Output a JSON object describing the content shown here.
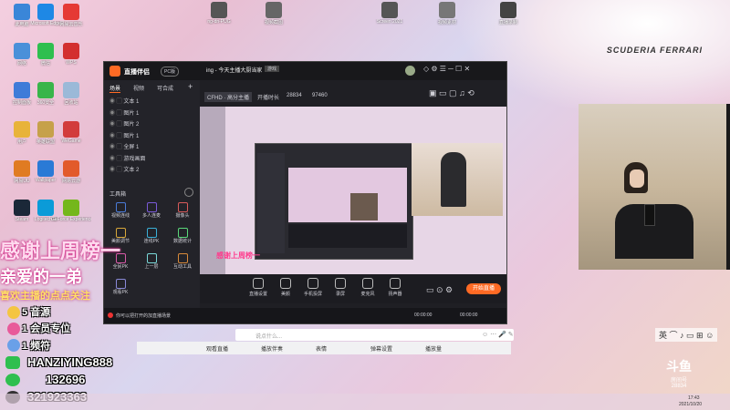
{
  "desktop": {
    "icons": [
      {
        "label": "此电脑",
        "color": "#3a86d8"
      },
      {
        "label": "Microsoft Edge",
        "color": "#1e88e5"
      },
      {
        "label": "网易云音乐",
        "color": "#e53935"
      },
      {
        "label": "网络",
        "color": "#4a90d9"
      },
      {
        "label": "微信",
        "color": "#2fbf4f"
      },
      {
        "label": "WPS",
        "color": "#d32f2f"
      },
      {
        "label": "控制面板",
        "color": "#3f7bd8"
      },
      {
        "label": "360安全",
        "color": "#39b54a"
      },
      {
        "label": "回收站",
        "color": "#9bb9d8"
      },
      {
        "label": "用户",
        "color": "#e8b33a"
      },
      {
        "label": "英雄联盟",
        "color": "#c6a14a"
      },
      {
        "label": "WeGame",
        "color": "#d23c3c"
      },
      {
        "label": "网易UU",
        "color": "#e07b22"
      },
      {
        "label": "Wallpaper",
        "color": "#2a7ad6"
      },
      {
        "label": "网易云游",
        "color": "#e25a2b"
      },
      {
        "label": "Steam",
        "color": "#1b2838"
      },
      {
        "label": "Logitech G",
        "color": "#0b9bd8"
      },
      {
        "label": "GeForce Experience",
        "color": "#74b71b"
      }
    ],
    "top_icons": [
      {
        "label": "ng-dn-PUG",
        "color": "#555"
      },
      {
        "label": "视频截图",
        "color": "#666"
      },
      {
        "label": "Screen 2021",
        "color": "#555"
      },
      {
        "label": "视频素材",
        "color": "#777"
      },
      {
        "label": "直播录制",
        "color": "#444"
      }
    ],
    "ferrari_text": "SCUDERIA FERRARI"
  },
  "obs": {
    "logo": "直播伴侣",
    "badge": "PC版",
    "tabs": [
      "场景",
      "视频",
      "可合成"
    ],
    "scenes": [
      "文本 1",
      "图片 1",
      "图片 2",
      "图片 1",
      "全屏 1",
      "游戏画面",
      "文本 2"
    ],
    "tool_title": "工具箱",
    "tools": [
      "视频连线",
      "多人连麦",
      "摄像头",
      "美颜调节",
      "连线PK",
      "数据统计",
      "全民PK",
      "上一层",
      "互动工具",
      "观看PK"
    ],
    "stream_title": "ing - 今天主播大厨当家",
    "stream_tag": "游戏",
    "sub_info": [
      "CFHD · 高分主播",
      "开播时长",
      "28834",
      "97460"
    ],
    "controls": [
      {
        "label": "直播设置",
        "icon": "monitor-icon"
      },
      {
        "label": "美颜",
        "icon": "face-icon"
      },
      {
        "label": "手机投屏",
        "icon": "phone-icon"
      },
      {
        "label": "录屏",
        "icon": "record-icon"
      },
      {
        "label": "麦克风",
        "icon": "mic-icon"
      },
      {
        "label": "扬声器",
        "icon": "speaker-icon"
      }
    ],
    "start_button": "开始直播",
    "status_text": "你可以把打开的加直播场景",
    "status_right": [
      "00:00:00",
      "00:00:00"
    ]
  },
  "chat": {
    "placeholder": "说点什么...",
    "toolbar": [
      "观看直播",
      "播放伴奏",
      "表情",
      "弹幕设置",
      "播放量"
    ]
  },
  "overlay": {
    "thanks": "感谢上周榜一",
    "dear": "亲爱的一弟",
    "like": "喜欢主播的点点关注",
    "lines": [
      "5 音源",
      "1 会员专位",
      "1 频符"
    ],
    "contact_name": "HANZIYING888",
    "contact_wechat": "132696",
    "contact_qq": "321923363"
  },
  "douyu": {
    "logo": "斗鱼",
    "sub": "房间号",
    "room": "28834"
  },
  "taskbar": {
    "time": "17:43",
    "date": "2021/10/20",
    "ime": "英"
  }
}
